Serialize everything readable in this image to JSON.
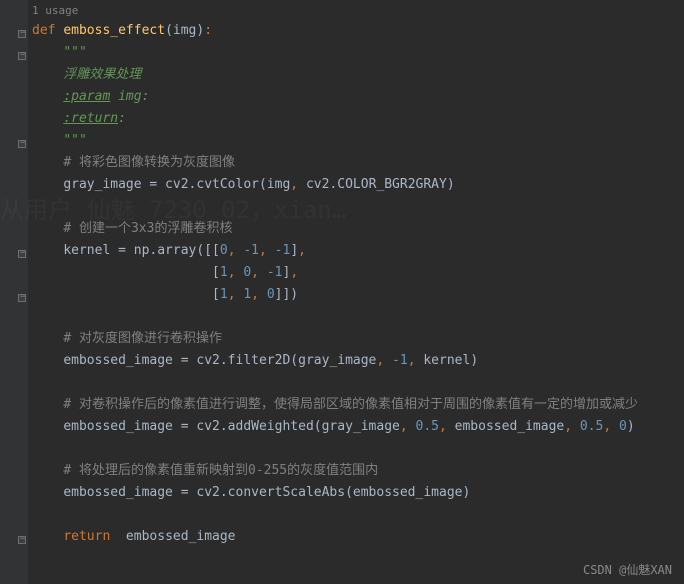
{
  "usage": "1 usage",
  "watermark": "从用户 仙魅\n7230_02，xian…",
  "credit": "CSDN @仙魅XAN",
  "code": {
    "kw_def": "def ",
    "func_name": "emboss_effect",
    "param": "img",
    "doc_open": "\"\"\"",
    "doc_desc": "浮雕效果处理",
    "doc_param_tag": ":param",
    "doc_param_text": " img:",
    "doc_return_tag": ":return",
    "doc_return_text": ":",
    "doc_close": "\"\"\"",
    "c1": "# 将彩色图像转换为灰度图像",
    "l1_a": "gray_image = cv2.cvtColor(img",
    "l1_b": " cv2.COLOR_BGR2GRAY)",
    "c2": "# 创建一个3x3的浮雕卷积核",
    "l2_a": "kernel = np.array([[",
    "l2_b": "                   [",
    "l2_c": "                   [",
    "n0": "0",
    "nm1": "-1",
    "n1": "1",
    "c3": "# 对灰度图像进行卷积操作",
    "l3_a": "embossed_image = cv2.filter2D(gray_image",
    "l3_b": " kernel)",
    "c4": "# 对卷积操作后的像素值进行调整，使得局部区域的像素值相对于周围的像素值有一定的增加或减少",
    "l4_a": "embossed_image = cv2.addWeighted(gray_image",
    "l4_b": " embossed_image",
    "n05": "0.5",
    "c5": "# 将处理后的像素值重新映射到0-255的灰度值范围内",
    "l5": "embossed_image = cv2.convertScaleAbs(embossed_image)",
    "kw_return": "return ",
    "ret_val": " embossed_image"
  }
}
